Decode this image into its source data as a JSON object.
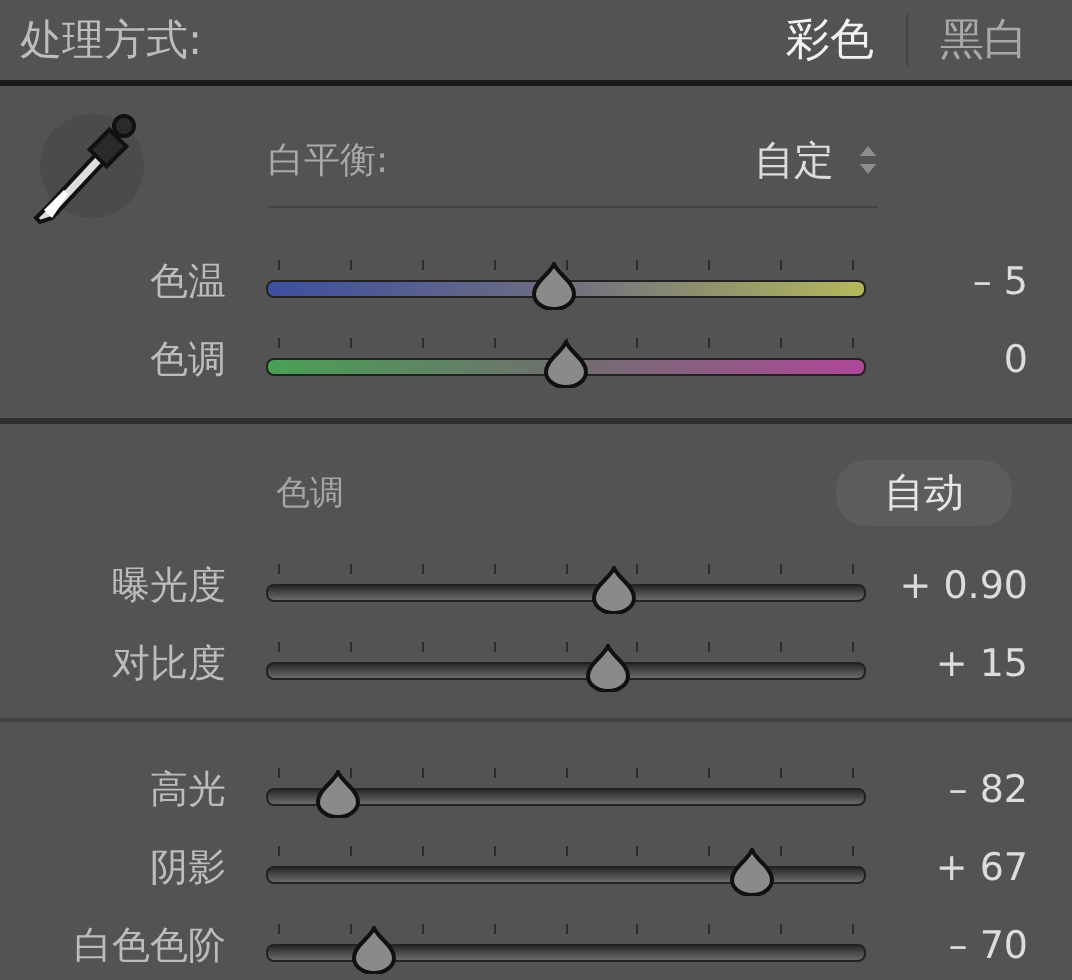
{
  "treatment": {
    "label": "处理方式:",
    "options": [
      {
        "label": "彩色",
        "selected": true
      },
      {
        "label": "黑白",
        "selected": false
      }
    ]
  },
  "white_balance": {
    "label": "白平衡:",
    "value": "自定"
  },
  "wb_sliders": [
    {
      "name": "色温",
      "kind": "temperature",
      "level": 0.48,
      "reading": "– 5"
    },
    {
      "name": "色调",
      "kind": "tint",
      "level": 0.5,
      "reading": "0"
    }
  ],
  "tone": {
    "label": "色调",
    "auto_button": "自动"
  },
  "tone_sliders": [
    {
      "name": "曝光度",
      "level": 0.58,
      "reading": "+ 0.90"
    },
    {
      "name": "对比度",
      "level": 0.57,
      "reading": "+ 15"
    }
  ],
  "presence_sliders": [
    {
      "name": "高光",
      "level": 0.12,
      "reading": "– 82"
    },
    {
      "name": "阴影",
      "level": 0.81,
      "reading": "+ 67"
    },
    {
      "name": "白色色阶",
      "level": 0.18,
      "reading": "– 70"
    }
  ]
}
